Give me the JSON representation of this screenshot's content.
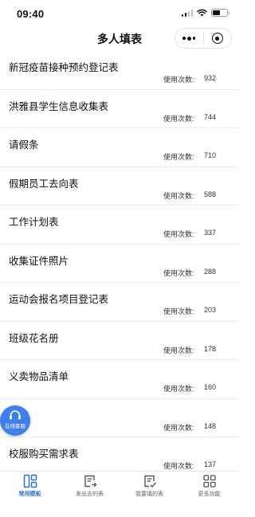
{
  "status_bar": {
    "time": "09:40"
  },
  "nav": {
    "title": "多人填表"
  },
  "templates": [
    {
      "title": "新冠疫苗接种预约登记表",
      "count_label": "使用次数:",
      "count": "932"
    },
    {
      "title": "洪雅县学生信息收集表",
      "count_label": "使用次数:",
      "count": "744"
    },
    {
      "title": "请假条",
      "count_label": "使用次数:",
      "count": "710"
    },
    {
      "title": "假期员工去向表",
      "count_label": "使用次数:",
      "count": "588"
    },
    {
      "title": "工作计划表",
      "count_label": "使用次数:",
      "count": "337"
    },
    {
      "title": "收集证件照片",
      "count_label": "使用次数:",
      "count": "288"
    },
    {
      "title": "运动会报名项目登记表",
      "count_label": "使用次数:",
      "count": "203"
    },
    {
      "title": "班级花名册",
      "count_label": "使用次数:",
      "count": "178"
    },
    {
      "title": "义卖物品清单",
      "count_label": "使用次数:",
      "count": "160"
    },
    {
      "title": "划表",
      "count_label": "使用次数:",
      "count": "148"
    },
    {
      "title": "校服购买需求表",
      "count_label": "使用次数:",
      "count": "137"
    }
  ],
  "service_fab": {
    "label": "在线客服"
  },
  "tabs": [
    {
      "label": "常用模板",
      "icon": "template-grid-icon",
      "active": true
    },
    {
      "label": "发出去的表",
      "icon": "send-form-icon",
      "active": false
    },
    {
      "label": "我要填的表",
      "icon": "fill-form-icon",
      "active": false
    },
    {
      "label": "更多功能",
      "icon": "more-grid-icon",
      "active": false
    }
  ],
  "colors": {
    "accent": "#2a6fdb",
    "fab": "#3d7ff0"
  }
}
